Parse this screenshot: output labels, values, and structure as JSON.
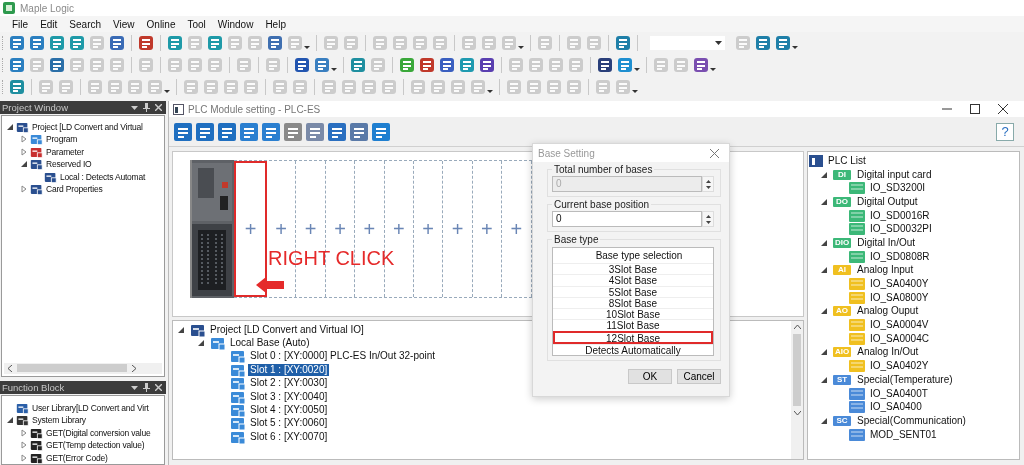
{
  "app": {
    "title": "Maple Logic"
  },
  "menu": [
    "File",
    "Edit",
    "Search",
    "View",
    "Online",
    "Tool",
    "Window",
    "Help"
  ],
  "toolbars": [
    [
      {
        "kind": "icon",
        "color": "#2b7fc0",
        "disabled": false
      },
      {
        "kind": "icon",
        "color": "#2b7fc0",
        "disabled": false
      },
      {
        "kind": "icon",
        "color": "#1f9aa8",
        "disabled": false
      },
      {
        "kind": "icon",
        "color": "#1f9aa8",
        "disabled": false
      },
      {
        "kind": "icon",
        "disabled": true
      },
      {
        "kind": "icon",
        "color": "#3a6bb5",
        "disabled": false
      },
      {
        "kind": "separator"
      },
      {
        "kind": "icon",
        "color": "#c0392b",
        "disabled": false
      },
      {
        "kind": "separator"
      },
      {
        "kind": "icon",
        "color": "#1f9aa8",
        "disabled": false
      },
      {
        "kind": "icon",
        "disabled": true
      },
      {
        "kind": "icon",
        "color": "#1f9aa8",
        "disabled": false
      },
      {
        "kind": "icon",
        "disabled": true
      },
      {
        "kind": "icon",
        "disabled": true
      },
      {
        "kind": "icon",
        "color": "#3f6fb0",
        "disabled": false
      },
      {
        "kind": "icon",
        "disabled": true
      },
      {
        "kind": "dropdown"
      },
      {
        "kind": "separator"
      },
      {
        "kind": "icon",
        "disabled": true
      },
      {
        "kind": "icon",
        "disabled": true
      },
      {
        "kind": "separator"
      },
      {
        "kind": "icon",
        "disabled": true
      },
      {
        "kind": "icon",
        "disabled": true
      },
      {
        "kind": "icon",
        "disabled": true
      },
      {
        "kind": "icon",
        "disabled": true
      },
      {
        "kind": "separator"
      },
      {
        "kind": "icon",
        "disabled": true
      },
      {
        "kind": "icon",
        "disabled": true
      },
      {
        "kind": "icon",
        "disabled": true
      },
      {
        "kind": "dropdown"
      },
      {
        "kind": "separator"
      },
      {
        "kind": "icon",
        "disabled": true
      },
      {
        "kind": "separator"
      },
      {
        "kind": "icon",
        "disabled": true
      },
      {
        "kind": "icon",
        "disabled": true
      },
      {
        "kind": "separator"
      },
      {
        "kind": "icon",
        "color": "#1f7fa8",
        "disabled": false
      },
      {
        "kind": "separator"
      },
      {
        "kind": "combo"
      },
      {
        "kind": "icon",
        "disabled": true
      },
      {
        "kind": "icon",
        "color": "#1f7fa8",
        "disabled": false
      },
      {
        "kind": "icon",
        "color": "#1f7fa8",
        "disabled": false
      },
      {
        "kind": "dropdown"
      }
    ],
    [
      {
        "kind": "icon",
        "color": "#2b7fc0",
        "disabled": false
      },
      {
        "kind": "icon",
        "disabled": true
      },
      {
        "kind": "icon",
        "color": "#2b6fa8",
        "disabled": false
      },
      {
        "kind": "icon",
        "disabled": true
      },
      {
        "kind": "icon",
        "disabled": true
      },
      {
        "kind": "icon",
        "disabled": true
      },
      {
        "kind": "separator"
      },
      {
        "kind": "icon",
        "disabled": true
      },
      {
        "kind": "separator"
      },
      {
        "kind": "icon",
        "disabled": true
      },
      {
        "kind": "icon",
        "disabled": true
      },
      {
        "kind": "icon",
        "disabled": true
      },
      {
        "kind": "separator"
      },
      {
        "kind": "icon",
        "disabled": true
      },
      {
        "kind": "separator"
      },
      {
        "kind": "icon",
        "disabled": true
      },
      {
        "kind": "separator"
      },
      {
        "kind": "icon",
        "color": "#2255b0",
        "disabled": false
      },
      {
        "kind": "icon",
        "color": "#3a7fc0",
        "disabled": false
      },
      {
        "kind": "dropdown"
      },
      {
        "kind": "separator"
      },
      {
        "kind": "icon",
        "color": "#1f8fa0",
        "disabled": false
      },
      {
        "kind": "icon",
        "disabled": true
      },
      {
        "kind": "separator"
      },
      {
        "kind": "icon",
        "color": "#3aa83a",
        "disabled": false
      },
      {
        "kind": "icon",
        "color": "#c0392b",
        "disabled": false
      },
      {
        "kind": "icon",
        "color": "#3a5fc0",
        "disabled": false
      },
      {
        "kind": "icon",
        "color": "#1f9ab0",
        "disabled": false
      },
      {
        "kind": "icon",
        "color": "#5a3fb0",
        "disabled": false
      },
      {
        "kind": "separator"
      },
      {
        "kind": "icon",
        "disabled": true
      },
      {
        "kind": "icon",
        "disabled": true
      },
      {
        "kind": "icon",
        "disabled": true
      },
      {
        "kind": "icon",
        "disabled": true
      },
      {
        "kind": "separator"
      },
      {
        "kind": "icon",
        "color": "#2a3f7a",
        "disabled": false
      },
      {
        "kind": "icon",
        "color": "#1f8fd0",
        "disabled": false
      },
      {
        "kind": "dropdown"
      },
      {
        "kind": "separator"
      },
      {
        "kind": "icon",
        "disabled": true
      },
      {
        "kind": "icon",
        "disabled": true
      },
      {
        "kind": "icon",
        "color": "#7a4fb0",
        "disabled": false
      },
      {
        "kind": "dropdown"
      }
    ],
    [
      {
        "kind": "icon",
        "color": "#1f8fa0",
        "disabled": false
      },
      {
        "kind": "separator"
      },
      {
        "kind": "icon",
        "disabled": true
      },
      {
        "kind": "icon",
        "disabled": true
      },
      {
        "kind": "separator"
      },
      {
        "kind": "icon",
        "disabled": true
      },
      {
        "kind": "icon",
        "disabled": true
      },
      {
        "kind": "icon",
        "disabled": true
      },
      {
        "kind": "icon",
        "disabled": true
      },
      {
        "kind": "dropdown"
      },
      {
        "kind": "separator"
      },
      {
        "kind": "icon",
        "disabled": true
      },
      {
        "kind": "icon",
        "disabled": true
      },
      {
        "kind": "icon",
        "disabled": true
      },
      {
        "kind": "icon",
        "disabled": true
      },
      {
        "kind": "separator"
      },
      {
        "kind": "icon",
        "disabled": true
      },
      {
        "kind": "icon",
        "disabled": true
      },
      {
        "kind": "separator"
      },
      {
        "kind": "icon",
        "disabled": true
      },
      {
        "kind": "icon",
        "disabled": true
      },
      {
        "kind": "icon",
        "disabled": true
      },
      {
        "kind": "icon",
        "disabled": true
      },
      {
        "kind": "separator"
      },
      {
        "kind": "icon",
        "disabled": true
      },
      {
        "kind": "icon",
        "disabled": true
      },
      {
        "kind": "icon",
        "disabled": true
      },
      {
        "kind": "icon",
        "disabled": true
      },
      {
        "kind": "dropdown"
      },
      {
        "kind": "separator"
      },
      {
        "kind": "icon",
        "disabled": true
      },
      {
        "kind": "icon",
        "disabled": true
      },
      {
        "kind": "icon",
        "disabled": true
      },
      {
        "kind": "icon",
        "disabled": true
      },
      {
        "kind": "separator"
      },
      {
        "kind": "icon",
        "disabled": true
      },
      {
        "kind": "icon",
        "disabled": true
      },
      {
        "kind": "dropdown"
      }
    ]
  ],
  "project_window": {
    "title": "Project Window",
    "tree": [
      {
        "label": "Project [LD Convert and Virtual",
        "color": "#2a4f8f",
        "expanded": true,
        "children": [
          {
            "label": "Program",
            "color": "#3a8ad8",
            "expanded": false
          },
          {
            "label": "Parameter",
            "color": "#c83030",
            "expanded": false
          },
          {
            "label": "Reserved IO",
            "color": "#2a4f8f",
            "expanded": true,
            "children": [
              {
                "label": "Local : Detects Automat",
                "color": "#2a4f8f"
              }
            ]
          },
          {
            "label": "Card Properties",
            "color": "#2a4f8f",
            "expanded": false
          }
        ]
      }
    ]
  },
  "function_block": {
    "title": "Function Block",
    "tree": [
      {
        "label": "User Library[LD Convert and Virt",
        "color": "#2a5fa8"
      },
      {
        "label": "System Library",
        "color": "#333333",
        "expanded": true,
        "children": [
          {
            "label": "GET(Digital conversion value",
            "color": "#222222",
            "expanded": false
          },
          {
            "label": "GET(Temp detection value)",
            "color": "#222222",
            "expanded": false
          },
          {
            "label": "GET(Error Code)",
            "color": "#222222",
            "expanded": false
          }
        ]
      }
    ]
  },
  "module_window": {
    "title": "PLC Module setting - PLC-ES",
    "toolbar": [
      {
        "color": "#1f6fc0"
      },
      {
        "color": "#1f6fc0"
      },
      {
        "color": "#1f6fc0"
      },
      {
        "color": "#2a7fd0"
      },
      {
        "color": "#2a7fd0"
      },
      {
        "color": "#8a8a8a"
      },
      {
        "color": "#7a8aa8"
      },
      {
        "color": "#2a6fc0"
      },
      {
        "color": "#5a7aa8"
      },
      {
        "color": "#1f7fd0"
      }
    ],
    "help": "?",
    "slots": [
      {
        "label": "+",
        "highlighted": true
      },
      {
        "label": "+",
        "highlighted": false
      },
      {
        "label": "+",
        "highlighted": false
      },
      {
        "label": "+",
        "highlighted": false
      },
      {
        "label": "+",
        "highlighted": false
      },
      {
        "label": "+",
        "highlighted": false
      },
      {
        "label": "+",
        "highlighted": false
      },
      {
        "label": "+",
        "highlighted": false
      },
      {
        "label": "+",
        "highlighted": false
      },
      {
        "label": "+",
        "highlighted": false
      }
    ],
    "annotation": "RIGHT CLICK",
    "tree": [
      {
        "label": "Project [LD Convert and Virtual IO]",
        "color": "#2a4f8f",
        "selected": false,
        "expanded": true,
        "children": [
          {
            "label": "Local Base (Auto)",
            "color": "#3a8ad8",
            "selected": false,
            "expanded": true,
            "children": [
              {
                "label": "Slot 0 : [XY:0000] PLC-ES In/Out 32-point",
                "color": "#3a8ad8",
                "selected": false
              },
              {
                "label": "Slot 1 : [XY:0020]",
                "color": "#3a8ad8",
                "selected": true
              },
              {
                "label": "Slot 2 : [XY:0030]",
                "color": "#3a8ad8",
                "selected": false
              },
              {
                "label": "Slot 3 : [XY:0040]",
                "color": "#3a8ad8",
                "selected": false
              },
              {
                "label": "Slot 4 : [XY:0050]",
                "color": "#3a8ad8",
                "selected": false
              },
              {
                "label": "Slot 5 : [XY:0060]",
                "color": "#3a8ad8",
                "selected": false
              },
              {
                "label": "Slot 6 : [XY:0070]",
                "color": "#3a8ad8",
                "selected": false
              }
            ]
          }
        ]
      }
    ],
    "plc_list": {
      "title": "PLC List",
      "categories": [
        {
          "label": "Digital input card",
          "badge": "DI",
          "color": "#3cb878",
          "expanded": true,
          "children": [
            {
              "label": "IO_SD3200I"
            }
          ]
        },
        {
          "label": "Digital Output",
          "badge": "DO",
          "color": "#3cb878",
          "expanded": true,
          "children": [
            {
              "label": "IO_SD0016R"
            },
            {
              "label": "IO_SD0032PI"
            }
          ]
        },
        {
          "label": "Digital In/Out",
          "badge": "DIO",
          "color": "#3cb878",
          "expanded": true,
          "children": [
            {
              "label": "IO_SD0808R"
            }
          ]
        },
        {
          "label": "Analog Input",
          "badge": "AI",
          "color": "#f0c020",
          "expanded": true,
          "children": [
            {
              "label": "IO_SA0400Y"
            },
            {
              "label": "IO_SA0800Y"
            }
          ]
        },
        {
          "label": "Analog Ouput",
          "badge": "AO",
          "color": "#f0c020",
          "expanded": true,
          "children": [
            {
              "label": "IO_SA0004V"
            },
            {
              "label": "IO_SA0004C"
            }
          ]
        },
        {
          "label": "Analog In/Out",
          "badge": "AIO",
          "color": "#f0c020",
          "expanded": true,
          "children": [
            {
              "label": "IO_SA0402Y"
            }
          ]
        },
        {
          "label": "Special(Temperature)",
          "badge": "ST",
          "color": "#4a8ad8",
          "expanded": true,
          "children": [
            {
              "label": "IO_SA0400T"
            },
            {
              "label": "IO_SA0400"
            }
          ]
        },
        {
          "label": "Special(Communication)",
          "badge": "SC",
          "color": "#4a8ad8",
          "expanded": true,
          "children": [
            {
              "label": "MOD_SENT01"
            }
          ]
        }
      ]
    }
  },
  "dialog": {
    "title": "Base Setting",
    "fields": [
      {
        "label": "Total number of bases",
        "value": "0",
        "disabled": true
      },
      {
        "label": "Current base position",
        "value": "0",
        "disabled": false
      }
    ],
    "base_type": {
      "label": "Base type",
      "header": "Base type selection",
      "options": [
        {
          "label": "3Slot Base",
          "selected": false
        },
        {
          "label": "4Slot Base",
          "selected": false
        },
        {
          "label": "5Slot Base",
          "selected": false
        },
        {
          "label": "8Slot Base",
          "selected": false
        },
        {
          "label": "10Slot Base",
          "selected": false
        },
        {
          "label": "11Slot Base",
          "selected": false
        },
        {
          "label": "12Slot Base",
          "selected": true
        },
        {
          "label": "Detects Automatically",
          "selected": false
        }
      ]
    },
    "buttons": [
      "OK",
      "Cancel"
    ]
  }
}
